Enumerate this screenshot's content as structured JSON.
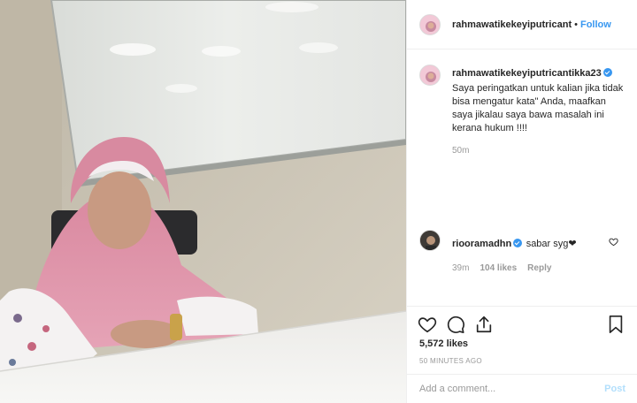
{
  "post": {
    "photo_alt_icon": "photo",
    "author": "rahmawatikekeyiputricant",
    "follow_label": "Follow",
    "separator": "•"
  },
  "comments": [
    {
      "username": "rahmawatikekeyiputricantikka23",
      "verified": true,
      "text": "Saya peringatkan untuk kalian jika tidak bisa mengatur kata\" Anda, maafkan saya jikalau saya bawa masalah ini kerana hukum !!!!",
      "age": "50m"
    },
    {
      "username": "riooramadhn",
      "verified": true,
      "text": "sabar syg❤",
      "age": "39m",
      "likes": "104 likes",
      "reply_label": "Reply"
    }
  ],
  "actions": {
    "like_icon": "heart-icon",
    "comment_icon": "comment-icon",
    "share_icon": "share-icon",
    "save_icon": "bookmark-icon"
  },
  "stats": {
    "likes": "5,572 likes",
    "posted": "50 MINUTES AGO"
  },
  "add_comment": {
    "placeholder": "Add a comment...",
    "post_label": "Post"
  },
  "colors": {
    "accent": "#3897f0",
    "post_disabled": "#b2dffc",
    "muted": "#999999"
  }
}
